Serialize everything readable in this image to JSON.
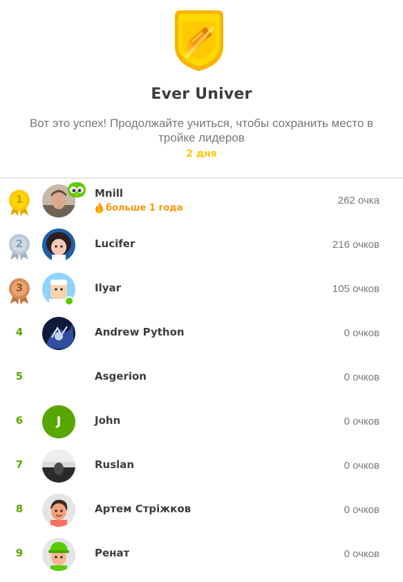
{
  "league": {
    "badge_icon": "gold-shield-pencil-icon",
    "title": "Ever Univer",
    "message_line1": "Вот это успех! Продолжайте учиться, чтобы сохранить место в",
    "message_line2": "тройке лидеров",
    "days_left": "2 дня",
    "colors": {
      "days": "#ffc800",
      "rank": "#58a700",
      "streak": "#ff9600",
      "gold": "#ffc800",
      "silver": "#b9c8d6",
      "bronze": "#d68a53"
    }
  },
  "leaderboard": [
    {
      "rank": "1",
      "medal": "gold",
      "name": "Mnill",
      "streak": "больше 1 года",
      "xp": "262 очка"
    },
    {
      "rank": "2",
      "medal": "silver",
      "name": "Lucifer",
      "xp": "216 очков"
    },
    {
      "rank": "3",
      "medal": "bronze",
      "name": "Ilyar",
      "xp": "105 очков"
    },
    {
      "rank": "4",
      "name": "Andrew Python",
      "xp": "0 очков"
    },
    {
      "rank": "5",
      "name": "Asgerion",
      "xp": "0 очков"
    },
    {
      "rank": "6",
      "name": "John",
      "avatar_letter": "J",
      "xp": "0 очков"
    },
    {
      "rank": "7",
      "name": "Ruslan",
      "xp": "0 очков"
    },
    {
      "rank": "8",
      "name": "Артем Стріжков",
      "xp": "0 очков"
    },
    {
      "rank": "9",
      "name": "Ренат",
      "xp": "0 очков"
    }
  ]
}
